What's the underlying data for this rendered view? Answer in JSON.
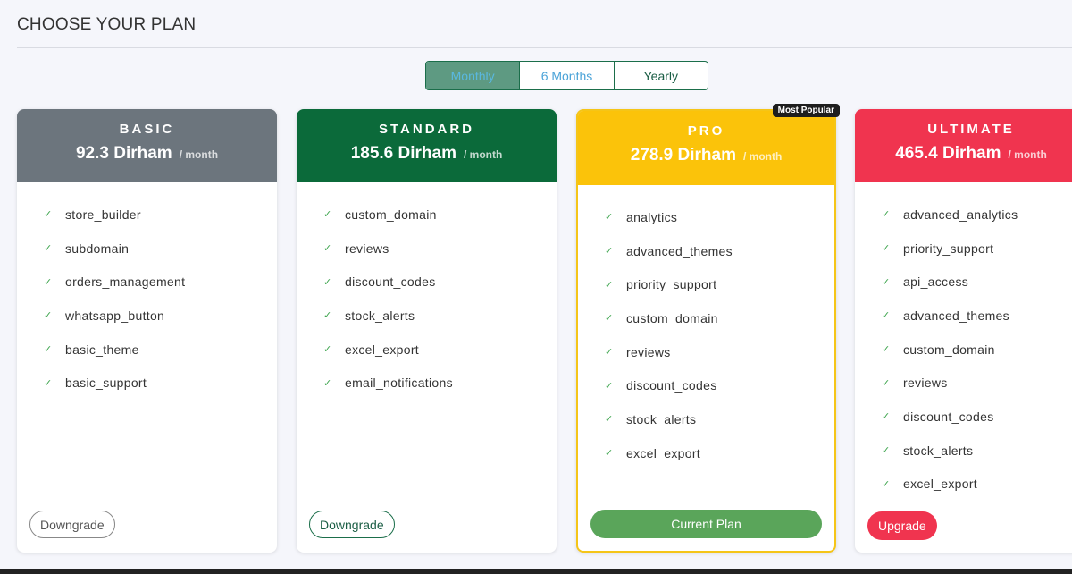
{
  "page": {
    "title": "CHOOSE YOUR PLAN"
  },
  "billing_toggle": {
    "options": [
      "Monthly",
      "6 Months",
      "Yearly"
    ],
    "selected": "Monthly"
  },
  "plans": [
    {
      "name": "BASIC",
      "price": "92.3 Dirham",
      "period": "/ month",
      "color": "#6c757d",
      "features": [
        "store_builder",
        "subdomain",
        "orders_management",
        "whatsapp_button",
        "basic_theme",
        "basic_support"
      ],
      "action": "Downgrade"
    },
    {
      "name": "STANDARD",
      "price": "185.6 Dirham",
      "period": "/ month",
      "color": "#0b6a3a",
      "features": [
        "custom_domain",
        "reviews",
        "discount_codes",
        "stock_alerts",
        "excel_export",
        "email_notifications"
      ],
      "action": "Downgrade"
    },
    {
      "name": "PRO",
      "price": "278.9 Dirham",
      "period": "/ month",
      "color": "#fbc30a",
      "badge": "Most Popular",
      "features": [
        "analytics",
        "advanced_themes",
        "priority_support",
        "custom_domain",
        "reviews",
        "discount_codes",
        "stock_alerts",
        "excel_export"
      ],
      "action": "Current Plan"
    },
    {
      "name": "ULTIMATE",
      "price": "465.4 Dirham",
      "period": "/ month",
      "color": "#f0344f",
      "features": [
        "advanced_analytics",
        "priority_support",
        "api_access",
        "advanced_themes",
        "custom_domain",
        "reviews",
        "discount_codes",
        "stock_alerts",
        "excel_export"
      ],
      "action": "Upgrade"
    }
  ],
  "icons": {
    "feature": "check-icon"
  }
}
